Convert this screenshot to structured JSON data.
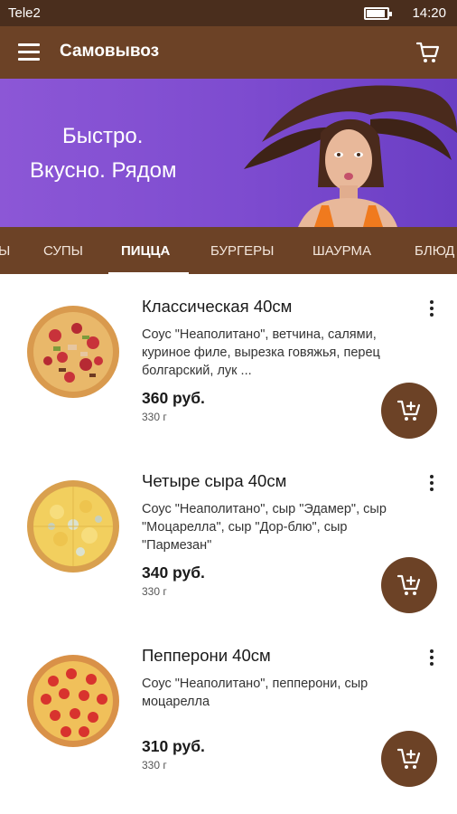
{
  "status_bar": {
    "carrier": "Tele2",
    "time": "14:20",
    "battery_level": 0.85
  },
  "app_bar": {
    "title": "Самовывоз",
    "menu_icon": "menu-icon",
    "cart_icon": "cart-icon"
  },
  "banner": {
    "line1": "Быстро.",
    "line2": "Вкусно. Рядом"
  },
  "tabs": [
    {
      "label": "Ы",
      "active": false
    },
    {
      "label": "СУПЫ",
      "active": false
    },
    {
      "label": "ПИЦЦА",
      "active": true
    },
    {
      "label": "БУРГЕРЫ",
      "active": false
    },
    {
      "label": "ШАУРМА",
      "active": false
    },
    {
      "label": "БЛЮД",
      "active": false
    }
  ],
  "products": [
    {
      "name": "Классическая 40см",
      "description": "Соус \"Неаполитано\", ветчина, салями, куриное филе, вырезка говяжья, перец болгарский, лук ...",
      "price": "360 руб.",
      "weight": "330 г"
    },
    {
      "name": "Четыре сыра 40см",
      "description": "Соус \"Неаполитано\", сыр \"Эдамер\", сыр \"Моцарелла\", сыр \"Дор-блю\", сыр \"Пармезан\"",
      "price": "340 руб.",
      "weight": "330 г"
    },
    {
      "name": "Пепперони 40см",
      "description": "Соус \"Неаполитано\", пепперони, сыр моцарелла",
      "price": "310 руб.",
      "weight": "330 г"
    }
  ],
  "colors": {
    "brand_brown": "#6c4226",
    "status_brown": "#4a2e1d",
    "banner_purple": "#7d4bcf"
  }
}
